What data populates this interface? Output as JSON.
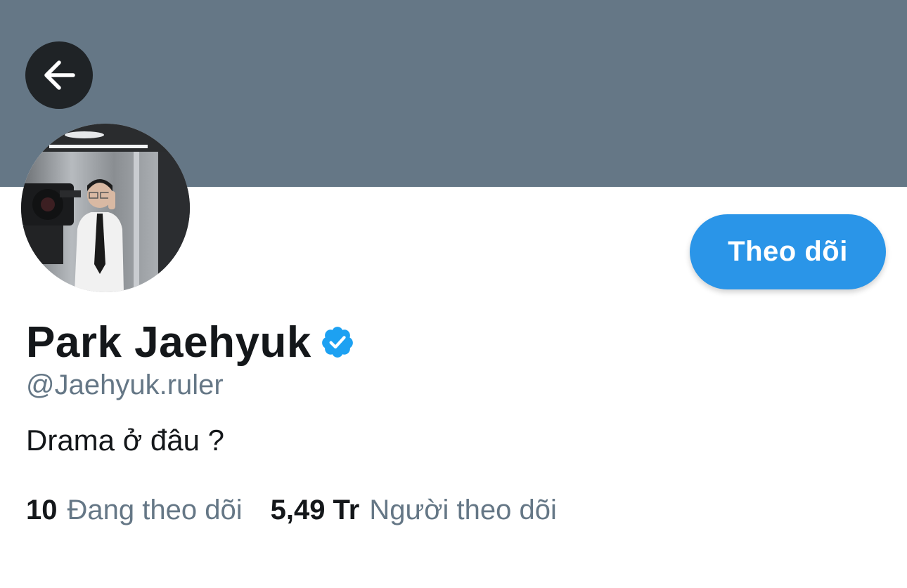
{
  "header": {
    "back_icon": "arrow-left-icon",
    "banner_color": "#657786"
  },
  "profile": {
    "display_name": "Park Jaehyuk",
    "verified": true,
    "verified_icon": "verified-badge-icon",
    "handle": "@Jaehyuk.ruler",
    "bio": "Drama ở đâu ?",
    "avatar_icon": "profile-photo"
  },
  "actions": {
    "follow_label": "Theo dõi",
    "follow_color": "#2a95e8"
  },
  "stats": {
    "following_count": "10",
    "following_label": "Đang theo dõi",
    "followers_count": "5,49 Tr",
    "followers_label": "Người theo dõi"
  }
}
